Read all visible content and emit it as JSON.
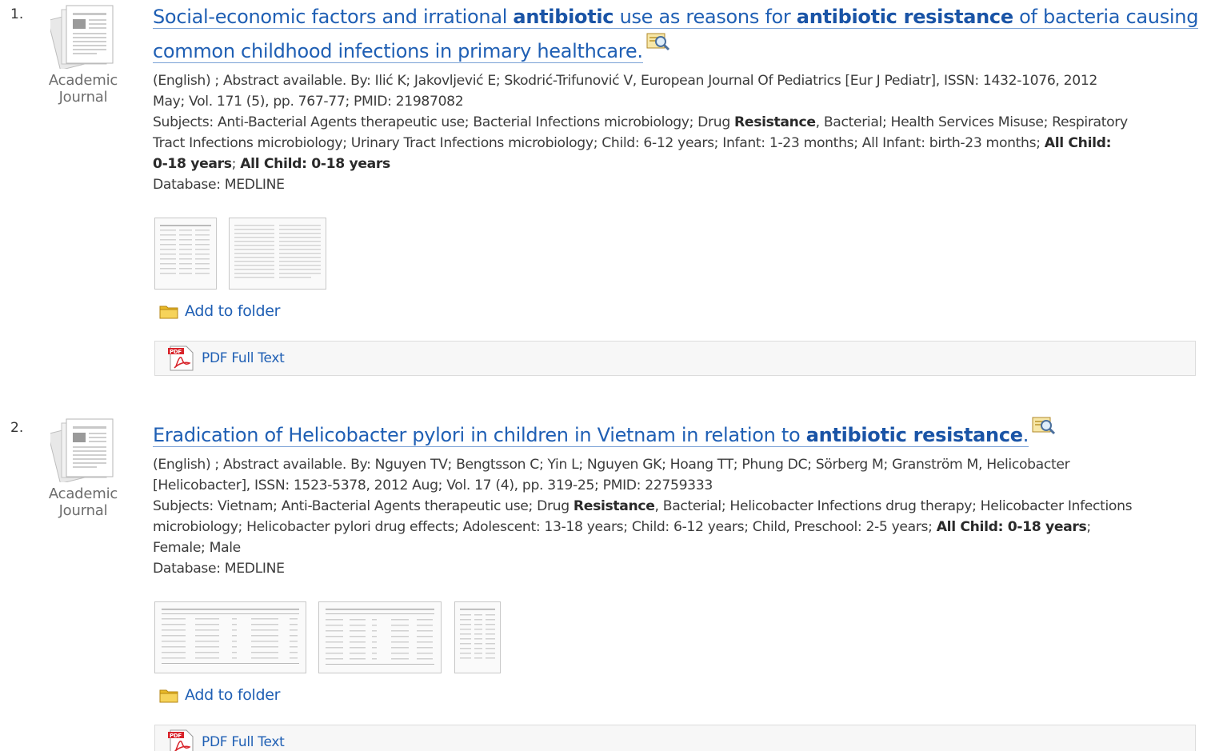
{
  "results": [
    {
      "number": "1.",
      "doc_type": [
        "Academic",
        "Journal"
      ],
      "title_line1": [
        {
          "t": "Social-economic factors and irrational ",
          "b": false
        },
        {
          "t": "antibiotic",
          "b": true
        },
        {
          "t": " use as reasons for ",
          "b": false
        },
        {
          "t": "antibiotic resistance",
          "b": true
        },
        {
          "t": " of bacteria causing",
          "b": false
        }
      ],
      "title_line2": "common childhood infections in primary healthcare.",
      "citation_line1": "(English) ; Abstract available. By: Ilić K; Jakovljević E; Skodrić-Trifunović V, European Journal Of Pediatrics [Eur J Pediatr], ISSN: 1432-1076, 2012",
      "citation_line2": "May; Vol. 171 (5), pp. 767-77; PMID: 21987082",
      "subjects_line1": [
        {
          "t": "Subjects: Anti-Bacterial Agents therapeutic use; Bacterial Infections microbiology; Drug ",
          "b": false
        },
        {
          "t": "Resistance",
          "b": true
        },
        {
          "t": ", Bacterial; Health Services Misuse; Respiratory",
          "b": false
        }
      ],
      "subjects_line2": [
        {
          "t": "Tract Infections microbiology; Urinary Tract Infections microbiology; Child: 6-12 years; Infant: 1-23 months; All Infant: birth-23 months; ",
          "b": false
        },
        {
          "t": "All Child:",
          "b": true
        }
      ],
      "subjects_line3": [
        {
          "t": "0-18 years",
          "b": true
        },
        {
          "t": "; ",
          "b": false
        },
        {
          "t": "All Child: 0-18 years",
          "b": true
        }
      ],
      "database": "Database: MEDLINE",
      "add_to_folder": "Add to folder",
      "full_text": "PDF Full Text"
    },
    {
      "number": "2.",
      "doc_type": [
        "Academic",
        "Journal"
      ],
      "title_line1": [
        {
          "t": "Eradication of Helicobacter pylori in children in Vietnam in relation to ",
          "b": false
        },
        {
          "t": "antibiotic resistance",
          "b": true
        },
        {
          "t": ".",
          "b": false
        }
      ],
      "citation_line1": "(English) ; Abstract available. By: Nguyen TV; Bengtsson C; Yin L; Nguyen GK; Hoang TT; Phung DC; Sörberg M; Granström M, Helicobacter",
      "citation_line2": "[Helicobacter], ISSN: 1523-5378, 2012 Aug; Vol. 17 (4), pp. 319-25; PMID: 22759333",
      "subjects_line1": [
        {
          "t": "Subjects: Vietnam; Anti-Bacterial Agents therapeutic use; Drug ",
          "b": false
        },
        {
          "t": "Resistance",
          "b": true
        },
        {
          "t": ", Bacterial; Helicobacter Infections drug therapy; Helicobacter Infections",
          "b": false
        }
      ],
      "subjects_line2": [
        {
          "t": "microbiology; Helicobacter pylori drug effects; Adolescent: 13-18 years; Child: 6-12 years; Child, Preschool: 2-5 years; ",
          "b": false
        },
        {
          "t": "All Child: 0-18 years",
          "b": true
        },
        {
          "t": ";",
          "b": false
        }
      ],
      "subjects_line3": [
        {
          "t": "Female; Male",
          "b": false
        }
      ],
      "database": "Database: MEDLINE",
      "add_to_folder": "Add to folder",
      "full_text": "PDF Full Text"
    }
  ],
  "icons": {
    "doc_type": "journal-page-icon",
    "preview": "magnifier-preview-icon",
    "folder": "folder-icon",
    "pdf": "pdf-icon"
  },
  "colors": {
    "link": "#1f5fb4",
    "text": "#3c3c3c"
  }
}
